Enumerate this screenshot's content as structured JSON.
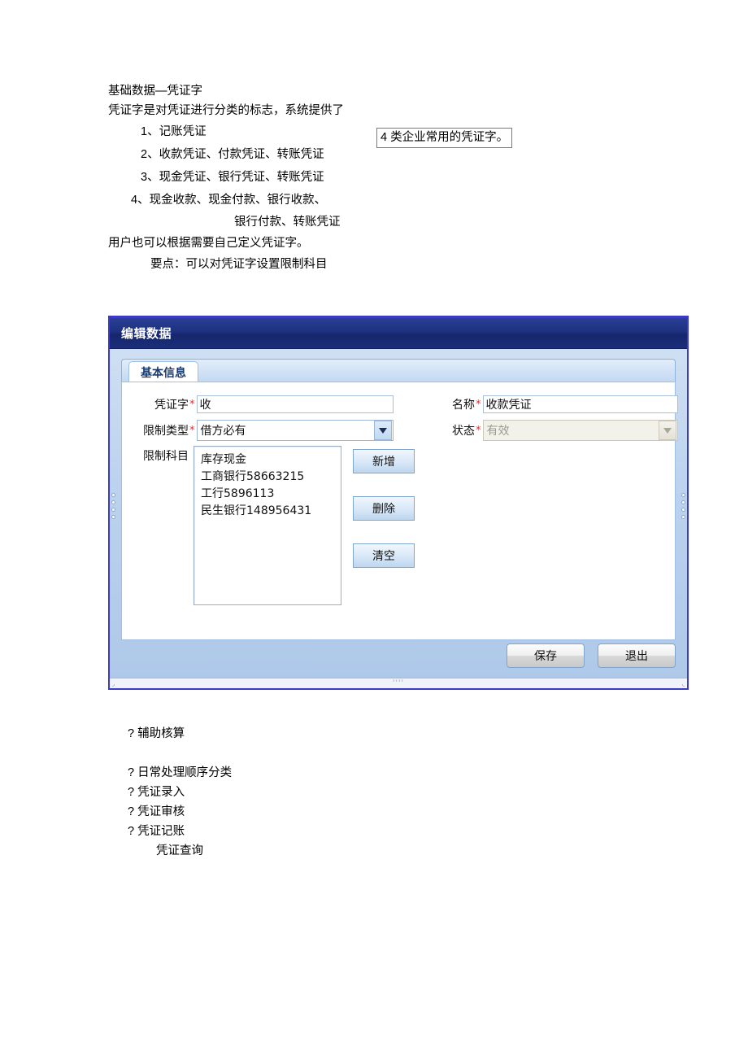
{
  "document": {
    "heading": "基础数据—凭证字",
    "intro_text": "凭证字是对凭证进行分类的标志，系统提供了",
    "boxed_note": "4 类企业常用的凭证字。",
    "numbered_items": [
      "1、记账凭证",
      "2、收款凭证、付款凭证、转账凭证",
      "3、现金凭证、银行凭证、转账凭证",
      "4、现金收款、现金付款、银行收款、"
    ],
    "continuation_line": "银行付款、转账凭证",
    "user_define_line": "用户也可以根据需要自己定义凭证字。",
    "key_point_line": "要点：可以对凭证字设置限制科目"
  },
  "dialog": {
    "title": "编辑数据",
    "tab": "基本信息",
    "fields": {
      "voucher_word_label": "凭证字",
      "voucher_word_value": "收",
      "name_label": "名称",
      "name_value": "收款凭证",
      "limit_type_label": "限制类型",
      "limit_type_value": "借方必有",
      "status_label": "状态",
      "status_value": "有效",
      "limit_subject_label": "限制科目",
      "required_mark": "*"
    },
    "limit_subject_items": [
      "库存现金",
      "工商银行58663215",
      "工行5896113",
      "民生银行148956431"
    ],
    "side_buttons": [
      "新增",
      "删除",
      "清空"
    ],
    "footer_buttons": [
      "保存",
      "退出"
    ],
    "colors": {
      "titlebar": "#1d3180",
      "body": "#bcd2ee",
      "border": "#3b3bc4",
      "required": "#e03030",
      "tab_text": "#1a3a6b"
    }
  },
  "bullets": {
    "marker": "?",
    "items": [
      "? 辅助核算",
      "? 日常处理顺序分类",
      "? 凭证录入",
      "? 凭证审核",
      "? 凭证记账"
    ],
    "sub_item": "凭证查询"
  }
}
